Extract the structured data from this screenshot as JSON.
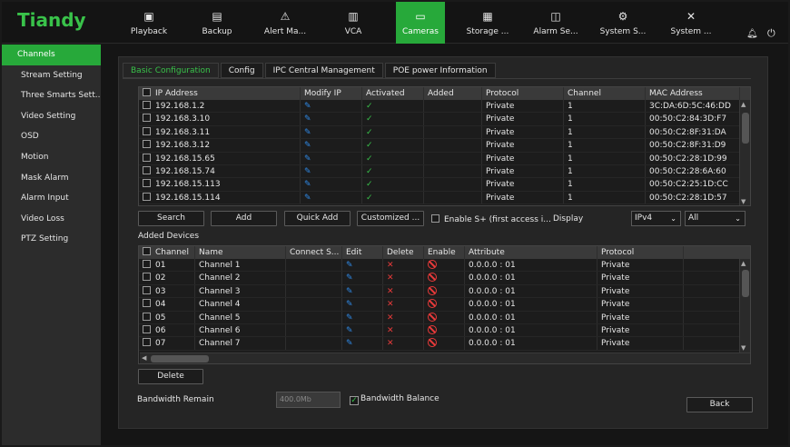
{
  "app": {
    "logo": "Tiandy"
  },
  "nav": [
    {
      "label": "Playback",
      "icon": "playback-icon",
      "glyph": "▣"
    },
    {
      "label": "Backup",
      "icon": "backup-icon",
      "glyph": "▤"
    },
    {
      "label": "Alert Ma...",
      "icon": "alert-icon",
      "glyph": "⚠"
    },
    {
      "label": "VCA",
      "icon": "vca-icon",
      "glyph": "▥"
    },
    {
      "label": "Cameras",
      "icon": "camera-icon",
      "glyph": "▭"
    },
    {
      "label": "Storage ...",
      "icon": "storage-icon",
      "glyph": "▦"
    },
    {
      "label": "Alarm Se...",
      "icon": "alarm-icon",
      "glyph": "◫"
    },
    {
      "label": "System S...",
      "icon": "system-settings-icon",
      "glyph": "⚙"
    },
    {
      "label": "System ...",
      "icon": "system-tools-icon",
      "glyph": "✕"
    }
  ],
  "nav_active": "Cameras",
  "sidebar": [
    {
      "label": "Channels"
    },
    {
      "label": "Stream Setting"
    },
    {
      "label": "Three Smarts Sett..."
    },
    {
      "label": "Video Setting"
    },
    {
      "label": "OSD"
    },
    {
      "label": "Motion"
    },
    {
      "label": "Mask Alarm"
    },
    {
      "label": "Alarm Input"
    },
    {
      "label": "Video Loss"
    },
    {
      "label": "PTZ Setting"
    }
  ],
  "tabs": [
    {
      "label": "Basic Configuration"
    },
    {
      "label": "Config"
    },
    {
      "label": "IPC Central Management"
    },
    {
      "label": "POE power Information"
    }
  ],
  "search_table": {
    "headers": [
      "IP Address",
      "Modify IP",
      "Activated",
      "Added",
      "Protocol",
      "Channel",
      "MAC Address"
    ],
    "rows": [
      {
        "ip": "192.168.1.2",
        "protocol": "Private",
        "channel": "1",
        "mac": "3C:DA:6D:5C:46:DD"
      },
      {
        "ip": "192.168.3.10",
        "protocol": "Private",
        "channel": "1",
        "mac": "00:50:C2:84:3D:F7"
      },
      {
        "ip": "192.168.3.11",
        "protocol": "Private",
        "channel": "1",
        "mac": "00:50:C2:8F:31:DA"
      },
      {
        "ip": "192.168.3.12",
        "protocol": "Private",
        "channel": "1",
        "mac": "00:50:C2:8F:31:D9"
      },
      {
        "ip": "192.168.15.65",
        "protocol": "Private",
        "channel": "1",
        "mac": "00:50:C2:28:1D:99"
      },
      {
        "ip": "192.168.15.74",
        "protocol": "Private",
        "channel": "1",
        "mac": "00:50:C2:28:6A:60"
      },
      {
        "ip": "192.168.15.113",
        "protocol": "Private",
        "channel": "1",
        "mac": "00:50:C2:25:1D:CC"
      },
      {
        "ip": "192.168.15.114",
        "protocol": "Private",
        "channel": "1",
        "mac": "00:50:C2:28:1D:57"
      }
    ]
  },
  "buttons": {
    "search": "Search",
    "add": "Add",
    "quick_add": "Quick Add",
    "customized": "Customized ...",
    "delete": "Delete",
    "back": "Back"
  },
  "enable_splus": "Enable S+ (first access i...",
  "display_label": "Display",
  "display_select": "IPv4",
  "filter_select": "All",
  "added_title": "Added Devices",
  "added_table": {
    "headers": [
      "Channel",
      "Name",
      "Connect S...",
      "Edit",
      "Delete",
      "Enable",
      "Attribute",
      "Protocol"
    ],
    "rows": [
      {
        "ch": "01",
        "name": "Channel 1",
        "attr": "0.0.0.0 : 01",
        "protocol": "Private"
      },
      {
        "ch": "02",
        "name": "Channel 2",
        "attr": "0.0.0.0 : 01",
        "protocol": "Private"
      },
      {
        "ch": "03",
        "name": "Channel 3",
        "attr": "0.0.0.0 : 01",
        "protocol": "Private"
      },
      {
        "ch": "04",
        "name": "Channel 4",
        "attr": "0.0.0.0 : 01",
        "protocol": "Private"
      },
      {
        "ch": "05",
        "name": "Channel 5",
        "attr": "0.0.0.0 : 01",
        "protocol": "Private"
      },
      {
        "ch": "06",
        "name": "Channel 6",
        "attr": "0.0.0.0 : 01",
        "protocol": "Private"
      },
      {
        "ch": "07",
        "name": "Channel 7",
        "attr": "0.0.0.0 : 01",
        "protocol": "Private"
      }
    ]
  },
  "bandwidth": {
    "label": "Bandwidth Remain",
    "value": "400.0Mb",
    "balance_label": "Bandwidth Balance",
    "balance_checked": true
  },
  "colors": {
    "accent": "#27a93a",
    "edit": "#2f8ae8",
    "danger": "#e83a3a"
  }
}
